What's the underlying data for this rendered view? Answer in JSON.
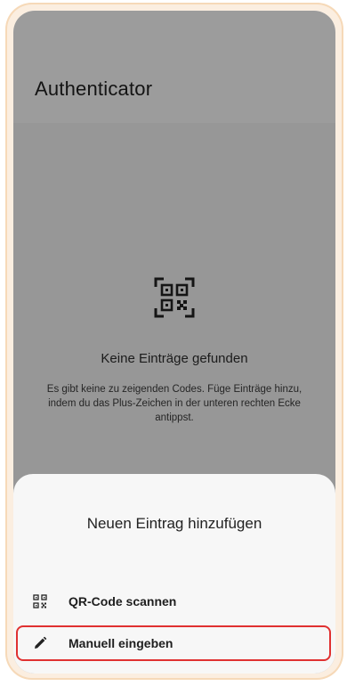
{
  "app": {
    "title": "Authenticator"
  },
  "empty_state": {
    "icon": "qr-code-scan-icon",
    "title": "Keine Einträge gefunden",
    "description": "Es gibt keine zu zeigenden Codes. Füge Einträge hinzu, indem du das Plus-Zeichen in der unteren rechten Ecke antippst."
  },
  "bottom_sheet": {
    "title": "Neuen Eintrag hinzufügen",
    "items": [
      {
        "icon": "qr-code-icon",
        "label": "QR-Code scannen"
      },
      {
        "icon": "pencil-icon",
        "label": "Manuell eingeben",
        "highlighted": true
      }
    ]
  },
  "colors": {
    "highlight": "#e03131",
    "scrim": "rgba(0,0,0,0.36)"
  }
}
